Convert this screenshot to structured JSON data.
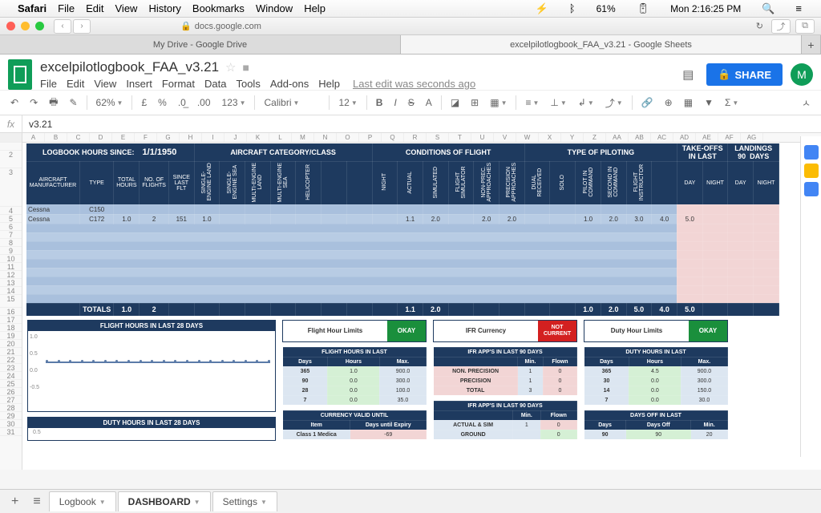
{
  "mac": {
    "app": "Safari",
    "menus": [
      "File",
      "Edit",
      "View",
      "History",
      "Bookmarks",
      "Window",
      "Help"
    ],
    "battery": "61%",
    "time": "Mon 2:16:25 PM"
  },
  "url": "docs.google.com",
  "tabs": [
    "My Drive - Google Drive",
    "excelpilotlogbook_FAA_v3.21 - Google Sheets"
  ],
  "doc": {
    "name": "excelpilotlogbook_FAA_v3.21",
    "menus": [
      "File",
      "Edit",
      "View",
      "Insert",
      "Format",
      "Data",
      "Tools",
      "Add-ons",
      "Help"
    ],
    "last_edit": "Last edit was seconds ago",
    "share": "SHARE",
    "avatar": "M"
  },
  "toolbar": {
    "zoom": "62%",
    "currency": "£",
    "pct": "%",
    "dec0": ".0",
    "dec00": ".00",
    "fmt": "123",
    "font": "Calibri",
    "size": "12"
  },
  "fx": {
    "value": "v3.21"
  },
  "cols": [
    "A",
    "B",
    "C",
    "D",
    "E",
    "F",
    "G",
    "H",
    "I",
    "J",
    "K",
    "L",
    "M",
    "N",
    "O",
    "P",
    "Q",
    "R",
    "S",
    "T",
    "U",
    "V",
    "W",
    "X",
    "Y",
    "Z",
    "AA",
    "AB",
    "AC",
    "AD",
    "AE",
    "AF",
    "AG"
  ],
  "dash": {
    "logbook_since_label": "LOGBOOK HOURS SINCE:",
    "logbook_since_date": "1/1/1950",
    "sections": [
      "AIRCRAFT CATEGORY/CLASS",
      "CONDITIONS OF FLIGHT",
      "TYPE OF PILOTING",
      "TAKE-OFFS",
      "LANDINGS"
    ],
    "inlast": "IN LAST",
    "ninety": "90",
    "days": "DAYS",
    "subhdrs": [
      "AIRCRAFT MANUFACTURER",
      "TYPE",
      "TOTAL HOURS",
      "NO. OF FLIGHTS",
      "SINCE LAST FLT",
      "SINGLE-ENGINE LAND",
      "SINGLE-ENGINE SEA",
      "MULTI-ENGINE LAND",
      "MULTI-ENGINE SEA",
      "HELICOPTER",
      "",
      "",
      "NIGHT",
      "ACTUAL",
      "SIMULATED",
      "FLIGHT SIMULATOR",
      "NON-PREC. APPROACHES",
      "PRECISION APPROACHES",
      "DUAL RECEIVED",
      "SOLO",
      "PILOT IN COMMAND",
      "SECOND IN COMMAND",
      "FLIGHT INSTRUCTOR",
      "",
      "DAY",
      "NIGHT",
      "DAY",
      "NIGHT"
    ],
    "rows": [
      {
        "mfr": "Cessna",
        "type": "C150"
      },
      {
        "mfr": "Cessna",
        "type": "C172",
        "total": "1.0",
        "flights": "2",
        "since": "151",
        "sel": "1.0",
        "actual": "1.1",
        "sim": "2.0",
        "np": "2.0",
        "prec": "2.0",
        "pic": "1.0",
        "sic": "2.0",
        "fi": "3.0",
        "dto": "4.0",
        "nto": "5.0"
      }
    ],
    "totals": {
      "label": "TOTALS",
      "total": "1.0",
      "flights": "2",
      "actual": "1.1",
      "sim": "2.0",
      "pic": "1.0",
      "sic": "2.0",
      "fi": "5.0",
      "dto": "4.0",
      "nto": "5.0"
    }
  },
  "charts": {
    "fh28": "FLIGHT HOURS IN LAST 28 DAYS",
    "dh28": "DUTY  HOURS IN LAST 28 DAYS",
    "ylabels": [
      "1.0",
      "0.5",
      "0.0",
      "-0.5"
    ]
  },
  "status": {
    "fhl": {
      "label": "Flight Hour Limits",
      "val": "OKAY"
    },
    "ifr": {
      "label": "IFR Currency",
      "val": "NOT CURRENT"
    },
    "dhl": {
      "label": "Duty Hour Limits",
      "val": "OKAY"
    }
  },
  "tables": {
    "fh": {
      "title": "FLIGHT HOURS IN LAST",
      "hdrs": [
        "Days",
        "Hours",
        "Max."
      ],
      "rows": [
        [
          "365",
          "1.0",
          "900.0"
        ],
        [
          "90",
          "0.0",
          "300.0"
        ],
        [
          "28",
          "0.0",
          "100.0"
        ],
        [
          "7",
          "0.0",
          "35.0"
        ]
      ]
    },
    "ifr": {
      "title": "IFR APP'S IN LAST   90   DAYS",
      "hdrs": [
        "",
        "Min.",
        "Flown"
      ],
      "rows": [
        [
          "NON. PRECISION",
          "1",
          "0"
        ],
        [
          "PRECISION",
          "1",
          "0"
        ],
        [
          "TOTAL",
          "3",
          "0"
        ]
      ]
    },
    "dh": {
      "title": "DUTY HOURS IN LAST",
      "hdrs": [
        "Days",
        "Hours",
        "Max."
      ],
      "rows": [
        [
          "365",
          "4.5",
          "900.0"
        ],
        [
          "30",
          "0.0",
          "300.0"
        ],
        [
          "14",
          "0.0",
          "150.0"
        ],
        [
          "7",
          "0.0",
          "30.0"
        ]
      ]
    },
    "cv": {
      "title": "CURRENCY VALID UNTIL",
      "hdrs": [
        "Item",
        "Days until Expiry"
      ],
      "rows": [
        [
          "Class 1 Medica",
          "-69"
        ]
      ]
    },
    "ifr2": {
      "title": "IFR APP'S IN LAST   90   DAYS",
      "hdrs": [
        "",
        "Min.",
        "Flown"
      ],
      "rows": [
        [
          "ACTUAL & SIM",
          "1",
          "0"
        ],
        [
          "GROUND",
          "",
          "0"
        ]
      ]
    },
    "doff": {
      "title": "DAYS OFF IN LAST",
      "hdrs": [
        "Days",
        "Days Off",
        "Min."
      ],
      "rows": [
        [
          "90",
          "90",
          "20"
        ]
      ]
    }
  },
  "sheets": [
    "Logbook",
    "DASHBOARD",
    "Settings"
  ]
}
